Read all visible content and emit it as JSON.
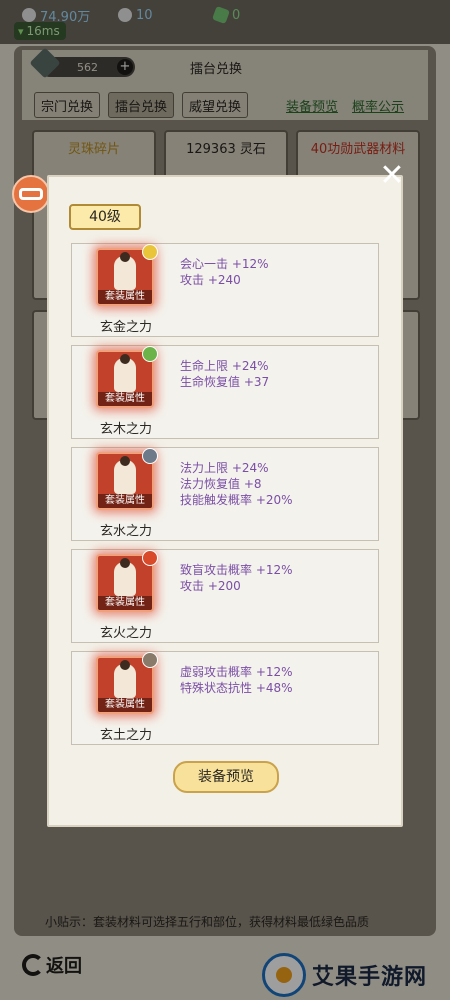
{
  "status": {
    "silver": "74.90万",
    "pearl": "10",
    "jade": "0",
    "ping": "16ms"
  },
  "header": {
    "coins": "562",
    "title": "擂台兑换"
  },
  "tabs": [
    "宗门兑换",
    "擂台兑换",
    "威望兑换"
  ],
  "links": [
    "装备预览",
    "概率公示"
  ],
  "bg_cards": [
    "灵珠碎片",
    "129363 灵石",
    "40功勋武器材料"
  ],
  "modal": {
    "level": "40级",
    "sets": [
      {
        "name": "玄金之力",
        "icon_caption": "套装属性",
        "element_color": "#e8c53b",
        "attrs": [
          "会心一击 +12%",
          "攻击 +240"
        ]
      },
      {
        "name": "玄木之力",
        "icon_caption": "套装属性",
        "element_color": "#6cb44a",
        "attrs": [
          "生命上限 +24%",
          "生命恢复值 +37"
        ]
      },
      {
        "name": "玄水之力",
        "icon_caption": "套装属性",
        "element_color": "#6e7a8a",
        "attrs": [
          "法力上限 +24%",
          "法力恢复值 +8",
          "技能触发概率 +20%"
        ]
      },
      {
        "name": "玄火之力",
        "icon_caption": "套装属性",
        "element_color": "#d94a2a",
        "attrs": [
          "致盲攻击概率 +12%",
          "攻击 +200"
        ]
      },
      {
        "name": "玄土之力",
        "icon_caption": "套装属性",
        "element_color": "#8a7a6a",
        "attrs": [
          "虚弱攻击概率 +12%",
          "特殊状态抗性 +48%"
        ]
      }
    ],
    "preview_button": "装备预览"
  },
  "tip": "小贴示：套装材料可选择五行和部位，获得材料最低绿色品质",
  "back_label": "返回",
  "watermark": "艾果手游网"
}
